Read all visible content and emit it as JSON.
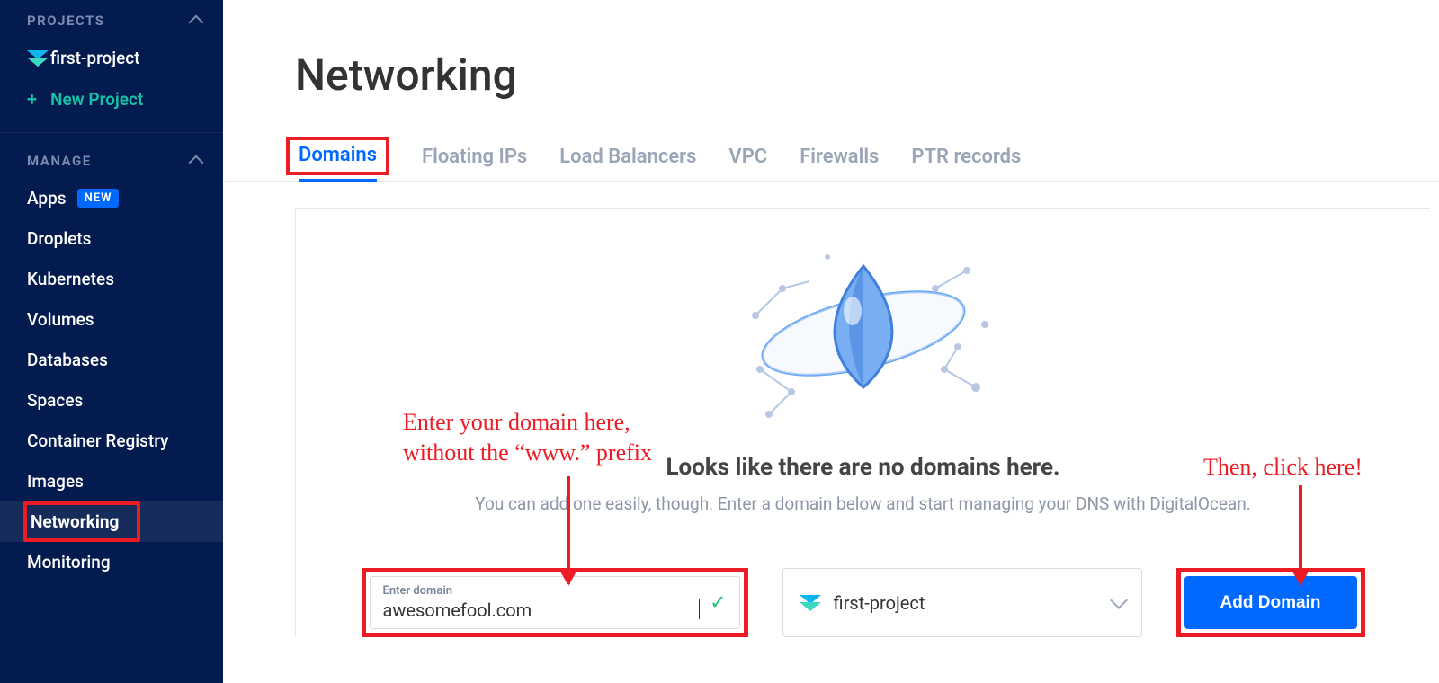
{
  "sidebar": {
    "projects_header": "PROJECTS",
    "first_project": "first-project",
    "new_project": "New Project",
    "manage_header": "MANAGE",
    "items": {
      "apps": "Apps",
      "apps_badge": "NEW",
      "droplets": "Droplets",
      "kubernetes": "Kubernetes",
      "volumes": "Volumes",
      "databases": "Databases",
      "spaces": "Spaces",
      "container_registry": "Container Registry",
      "images": "Images",
      "networking": "Networking",
      "monitoring": "Monitoring"
    }
  },
  "page": {
    "title": "Networking"
  },
  "tabs": {
    "domains": "Domains",
    "floating_ips": "Floating IPs",
    "load_balancers": "Load Balancers",
    "vpc": "VPC",
    "firewalls": "Firewalls",
    "ptr_records": "PTR records"
  },
  "empty": {
    "title": "Looks like there are no domains here.",
    "subtitle": "You can add one easily, though. Enter a domain below and start managing your DNS with DigitalOcean."
  },
  "form": {
    "domain_label": "Enter domain",
    "domain_value": "awesomefool.com",
    "project_selected": "first-project",
    "add_button": "Add Domain"
  },
  "annotations": {
    "left_line1": "Enter your domain here,",
    "left_line2": "without the “www.” prefix",
    "right": "Then, click here!"
  }
}
